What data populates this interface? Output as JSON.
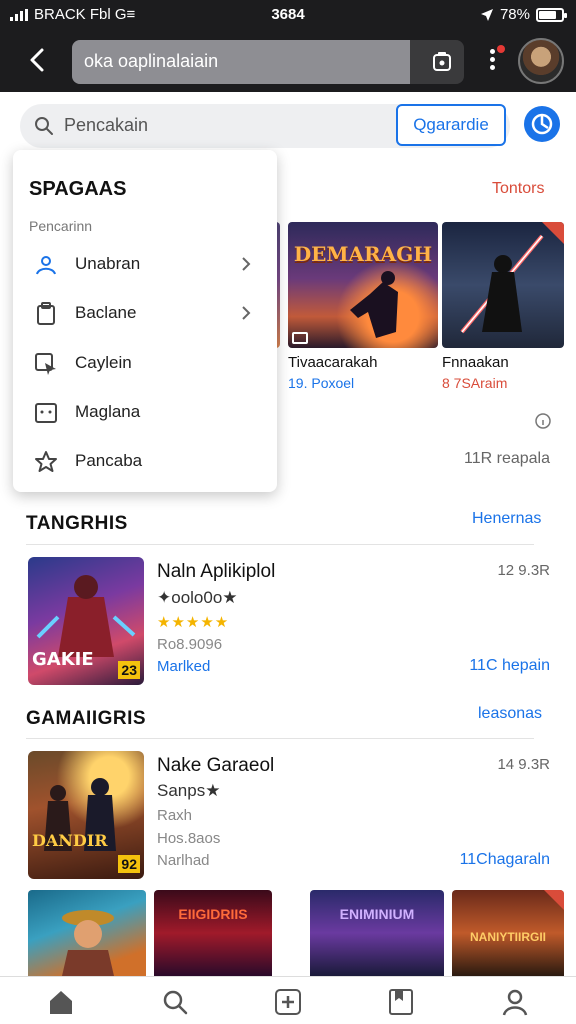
{
  "status_bar": {
    "carrier": "BRACK Fbl G≡",
    "time": "3684",
    "battery": "78%",
    "battery_fraction": 0.78
  },
  "header": {
    "url": "oka oaplinalaiain"
  },
  "search": {
    "placeholder": "Pencakain",
    "button_label": "Qgarardie"
  },
  "dropdown": {
    "title": "SPAGAAS",
    "subtitle": "Pencarinn",
    "items": [
      {
        "label": "Unabran",
        "icon": "user-share-icon",
        "chevron": true
      },
      {
        "label": "Baclane",
        "icon": "clipboard-icon",
        "chevron": true
      },
      {
        "label": "Caylein",
        "icon": "cursor-box-icon",
        "chevron": false
      },
      {
        "label": "Maglana",
        "icon": "dots-box-icon",
        "chevron": false
      },
      {
        "label": "Pancaba",
        "icon": "star-outline-icon",
        "chevron": false
      }
    ]
  },
  "featured": {
    "link": "Tontors",
    "more_link": "11R reapala",
    "cards": [
      {
        "thumb_text": "DEMARAGH",
        "title": "Tivaacarakah",
        "meta": "19. Poxoel"
      },
      {
        "thumb_text": "",
        "title": "Fnnaakan",
        "meta": "8 7SAraim"
      }
    ]
  },
  "section1": {
    "title": "TANGRHIS",
    "link": "Henernas",
    "app": {
      "title": "Naln Aplikiplol",
      "subtitle": "✦oolo0o★",
      "stars": "★★★★★",
      "rating_text": "★",
      "line1": "Ro8.9096",
      "line2": "Marlked",
      "right_top": "12 9.3R",
      "right_bottom": "11C hepain",
      "badge": "GAKIE",
      "badge_num": "23"
    }
  },
  "section2": {
    "title": "GAMAIIGRIS",
    "link": "leasonas",
    "app": {
      "title": "Nake Garaeol",
      "subtitle": "Sanps★",
      "line0": "Raxh",
      "line1": "Hos.8aos",
      "line2": "Narlhad",
      "right_top": "14 9.3R",
      "right_bottom": "11Chagaraln",
      "badge": "DANDIR",
      "badge_num": "92"
    }
  },
  "tiles": [
    {
      "text": ""
    },
    {
      "text": "EIIGIDRIIS"
    },
    {
      "text": "ENIMINIUM"
    },
    {
      "text": "NANIYTIIRGII"
    }
  ],
  "bottom_nav": [
    "home-icon",
    "search-icon",
    "add-box-icon",
    "bookmark-icon",
    "profile-icon"
  ],
  "colors": {
    "accent": "#1a73e8",
    "warning": "#d94c3a",
    "star": "#f4b400",
    "header_bg": "#1c1c1e"
  }
}
